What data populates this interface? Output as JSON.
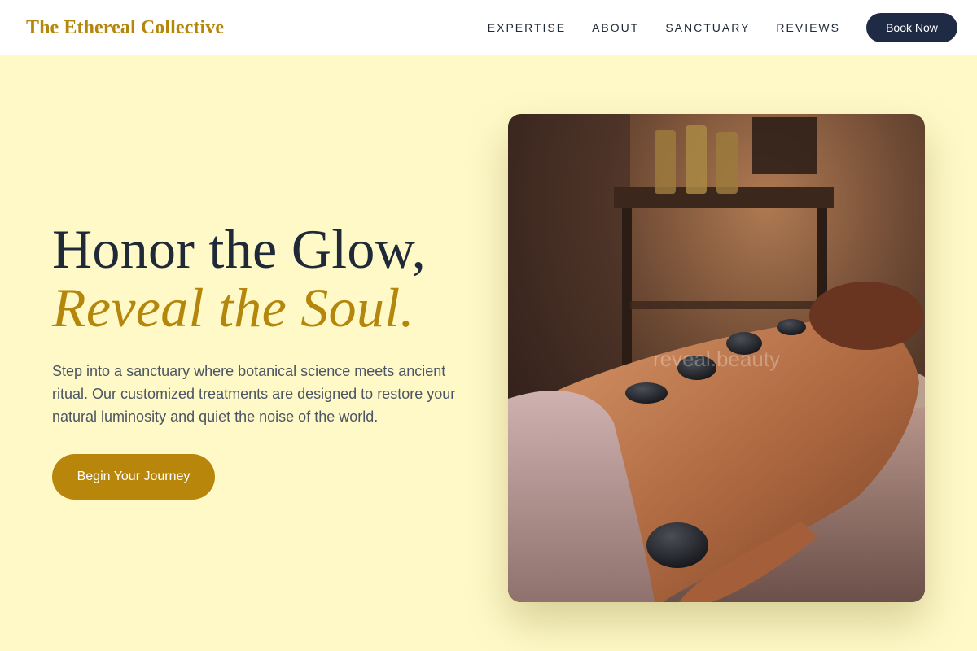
{
  "brand": {
    "name": "The Ethereal Collective"
  },
  "nav": {
    "links": [
      "EXPERTISE",
      "ABOUT",
      "SANCTUARY",
      "REVIEWS"
    ],
    "book_label": "Book Now"
  },
  "hero": {
    "headline_line1": "Honor the Glow,",
    "headline_line2": "Reveal the Soul.",
    "body": "Step into a sanctuary where botanical science meets ancient ritual. Our customized treatments are designed to restore your natural luminosity and quiet the noise of the world.",
    "cta_label": "Begin Your Journey"
  },
  "photo": {
    "watermark": "reveal.beauty"
  },
  "colors": {
    "background": "#fef9c7",
    "gold": "#b4860b",
    "navy": "#1f2a44",
    "ink": "#1f2937"
  }
}
